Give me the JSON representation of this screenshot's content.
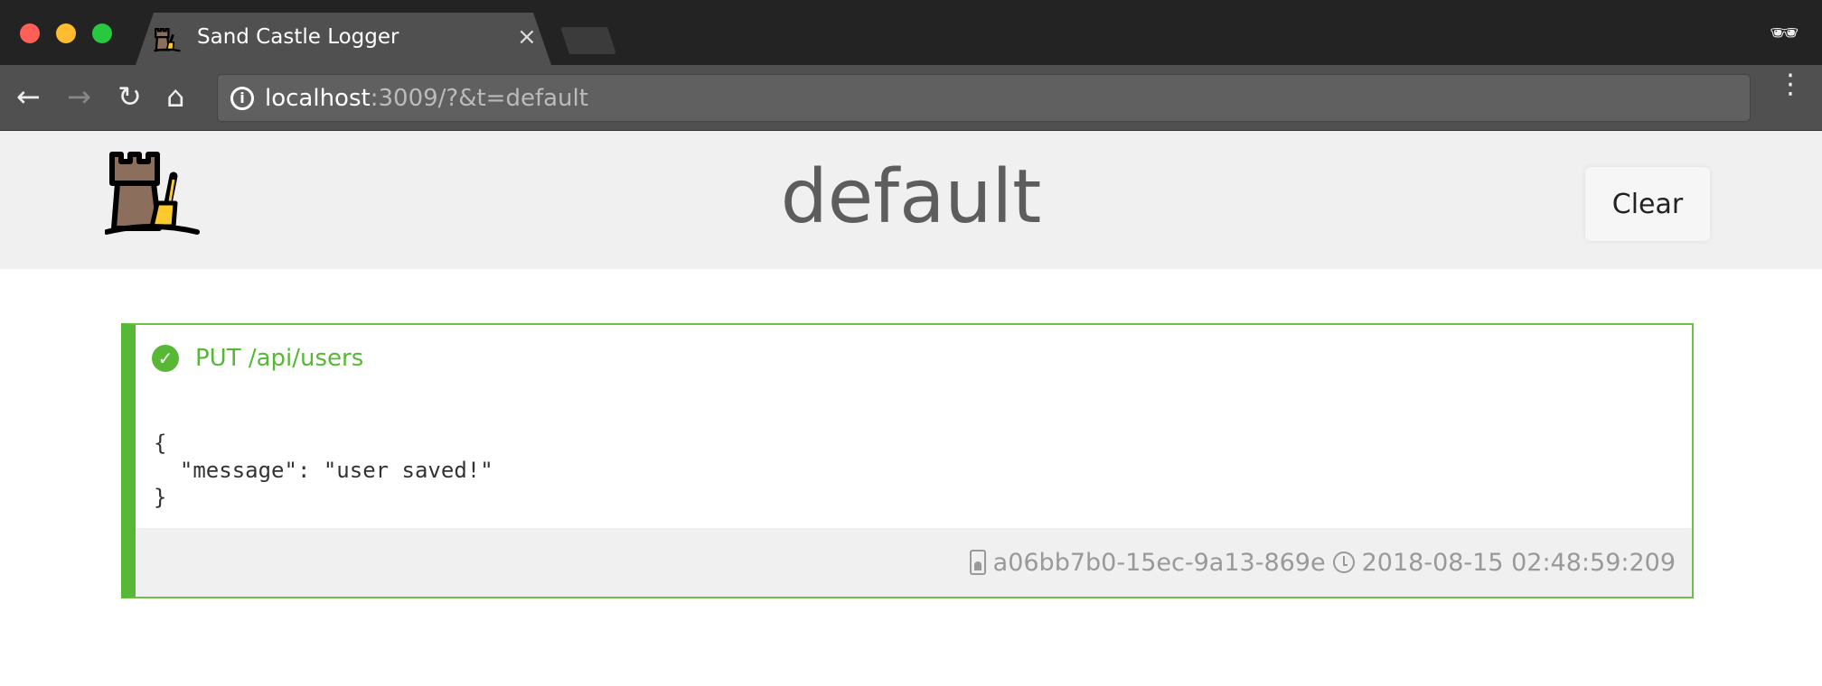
{
  "browser": {
    "tab_title": "Sand Castle Logger",
    "url_host": "localhost",
    "url_rest": ":3009/?&t=default",
    "traffic_colors": [
      "#fe5f57",
      "#febc2e",
      "#28c840"
    ]
  },
  "header": {
    "title": "default",
    "clear_label": "Clear"
  },
  "log": {
    "method_path": "PUT /api/users",
    "status": "success",
    "accent": "#57b835",
    "body": "{\n  \"message\": \"user saved!\"\n}",
    "id": "a06bb7b0-15ec-9a13-869e",
    "timestamp": "2018-08-15 02:48:59:209"
  }
}
